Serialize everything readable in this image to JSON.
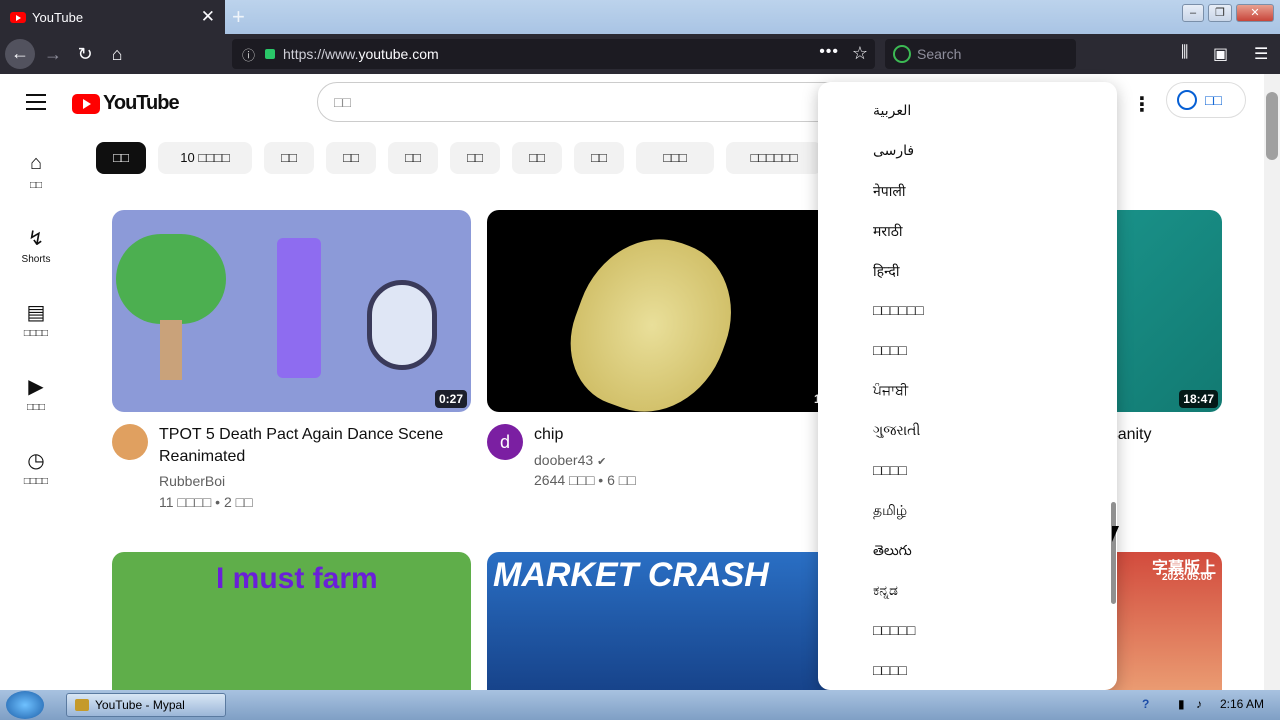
{
  "browser": {
    "tab_title": "YouTube",
    "url_prefix": "https://www.",
    "url_domain": "youtube.com",
    "search_placeholder": "Search"
  },
  "youtube": {
    "logo_text": "YouTube",
    "search_placeholder": "□□",
    "signin_label": "□□",
    "sidebar": [
      {
        "icon": "home-icon",
        "label": "□□"
      },
      {
        "icon": "shorts-icon",
        "label": "Shorts"
      },
      {
        "icon": "subscriptions-icon",
        "label": "□□□□"
      },
      {
        "icon": "library-icon",
        "label": "□□□"
      },
      {
        "icon": "history-icon",
        "label": "□□□□"
      }
    ],
    "chips": [
      "□□",
      "10 □□□□",
      "□□",
      "□□",
      "□□",
      "□□",
      "□□",
      "□□",
      "□□□",
      "□□□□□□"
    ],
    "videos": [
      {
        "title": "TPOT 5 Death Pact Again Dance Scene Reanimated",
        "channel": "RubberBoi",
        "views": "11 □□□□",
        "age": "2 □□",
        "duration": "0:27"
      },
      {
        "title": "chip",
        "channel": "doober43",
        "verified": true,
        "views": "2644 □□□",
        "age": "6 □□",
        "duration": "1:00"
      },
      {
        "title": "e Insanity",
        "duration": "18:47"
      }
    ],
    "second_row": [
      {
        "thumb_text": "I must farm"
      },
      {
        "thumb_text": "MARKET CRASH"
      },
      {
        "thumb_text": "字幕版上",
        "thumb_date": "2023.05.08"
      }
    ]
  },
  "language_menu": [
    "العربية",
    "فارسی",
    "नेपाली",
    "मराठी",
    "हिन्दी",
    "□□□□□□",
    "□□□□",
    "ਪੰਜਾਬੀ",
    "ગુજરાતી",
    "□□□□",
    "தமிழ்",
    "తెలుగు",
    "ಕನ್ನಡ",
    "□□□□□",
    "□□□□"
  ],
  "taskbar": {
    "window_label": "YouTube - Mypal",
    "clock": "2:16 AM"
  }
}
